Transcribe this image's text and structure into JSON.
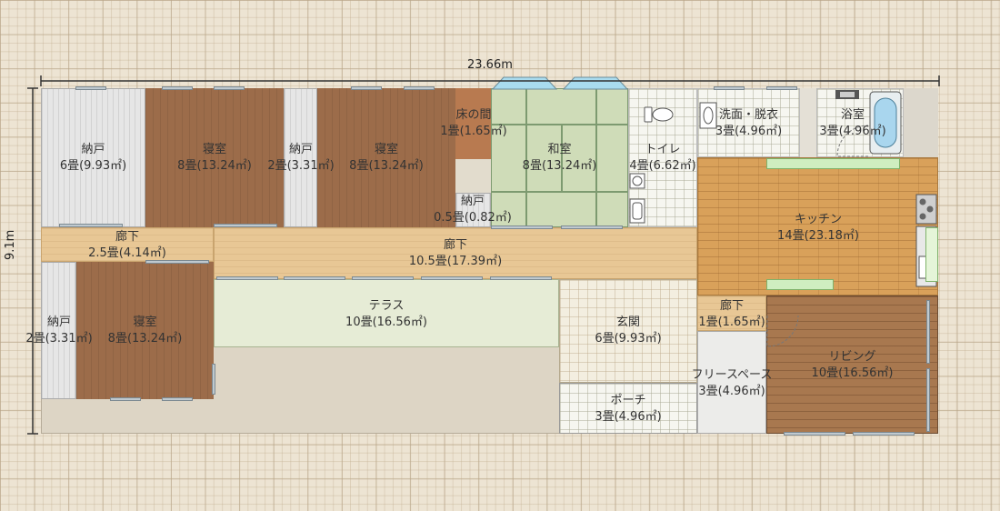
{
  "dimensions": {
    "width_label": "23.66m",
    "height_label": "9.1m"
  },
  "rooms": [
    {
      "name": "納戸",
      "size": "6畳(9.93㎡)"
    },
    {
      "name": "寝室",
      "size": "8畳(13.24㎡)"
    },
    {
      "name": "納戸",
      "size": "2畳(3.31㎡)"
    },
    {
      "name": "寝室",
      "size": "8畳(13.24㎡)"
    },
    {
      "name": "床の間",
      "size": "1畳(1.65㎡)"
    },
    {
      "name": "和室",
      "size": "8畳(13.24㎡)"
    },
    {
      "name": "トイレ",
      "size": "4畳(6.62㎡)"
    },
    {
      "name": "洗面・脱衣",
      "size": "3畳(4.96㎡)"
    },
    {
      "name": "浴室",
      "size": "3畳(4.96㎡)"
    },
    {
      "name": "納戸",
      "size": "0.5畳(0.82㎡)"
    },
    {
      "name": "廊下",
      "size": "2.5畳(4.14㎡)"
    },
    {
      "name": "廊下",
      "size": "10.5畳(17.39㎡)"
    },
    {
      "name": "キッチン",
      "size": "14畳(23.18㎡)"
    },
    {
      "name": "納戸",
      "size": "2畳(3.31㎡)"
    },
    {
      "name": "寝室",
      "size": "8畳(13.24㎡)"
    },
    {
      "name": "テラス",
      "size": "10畳(16.56㎡)"
    },
    {
      "name": "玄関",
      "size": "6畳(9.93㎡)"
    },
    {
      "name": "廊下",
      "size": "1畳(1.65㎡)"
    },
    {
      "name": "フリースペース",
      "size": "3畳(4.96㎡)"
    },
    {
      "name": "リビング",
      "size": "10畳(16.56㎡)"
    },
    {
      "name": "ポーチ",
      "size": "3畳(4.96㎡)"
    }
  ],
  "colors": {
    "tatami": "#cfdcb8",
    "wood_dark": "#9c6c4a",
    "hall": "#e8c795",
    "kitchen": "#d9a15a",
    "living": "#a8784f",
    "terrace": "#e6ecd6",
    "grid": "#ede4d3"
  },
  "icons": [
    "toilet-icon",
    "sink-icon",
    "bathtub-icon",
    "stove-icon",
    "door-swing-icon",
    "window-icon"
  ]
}
